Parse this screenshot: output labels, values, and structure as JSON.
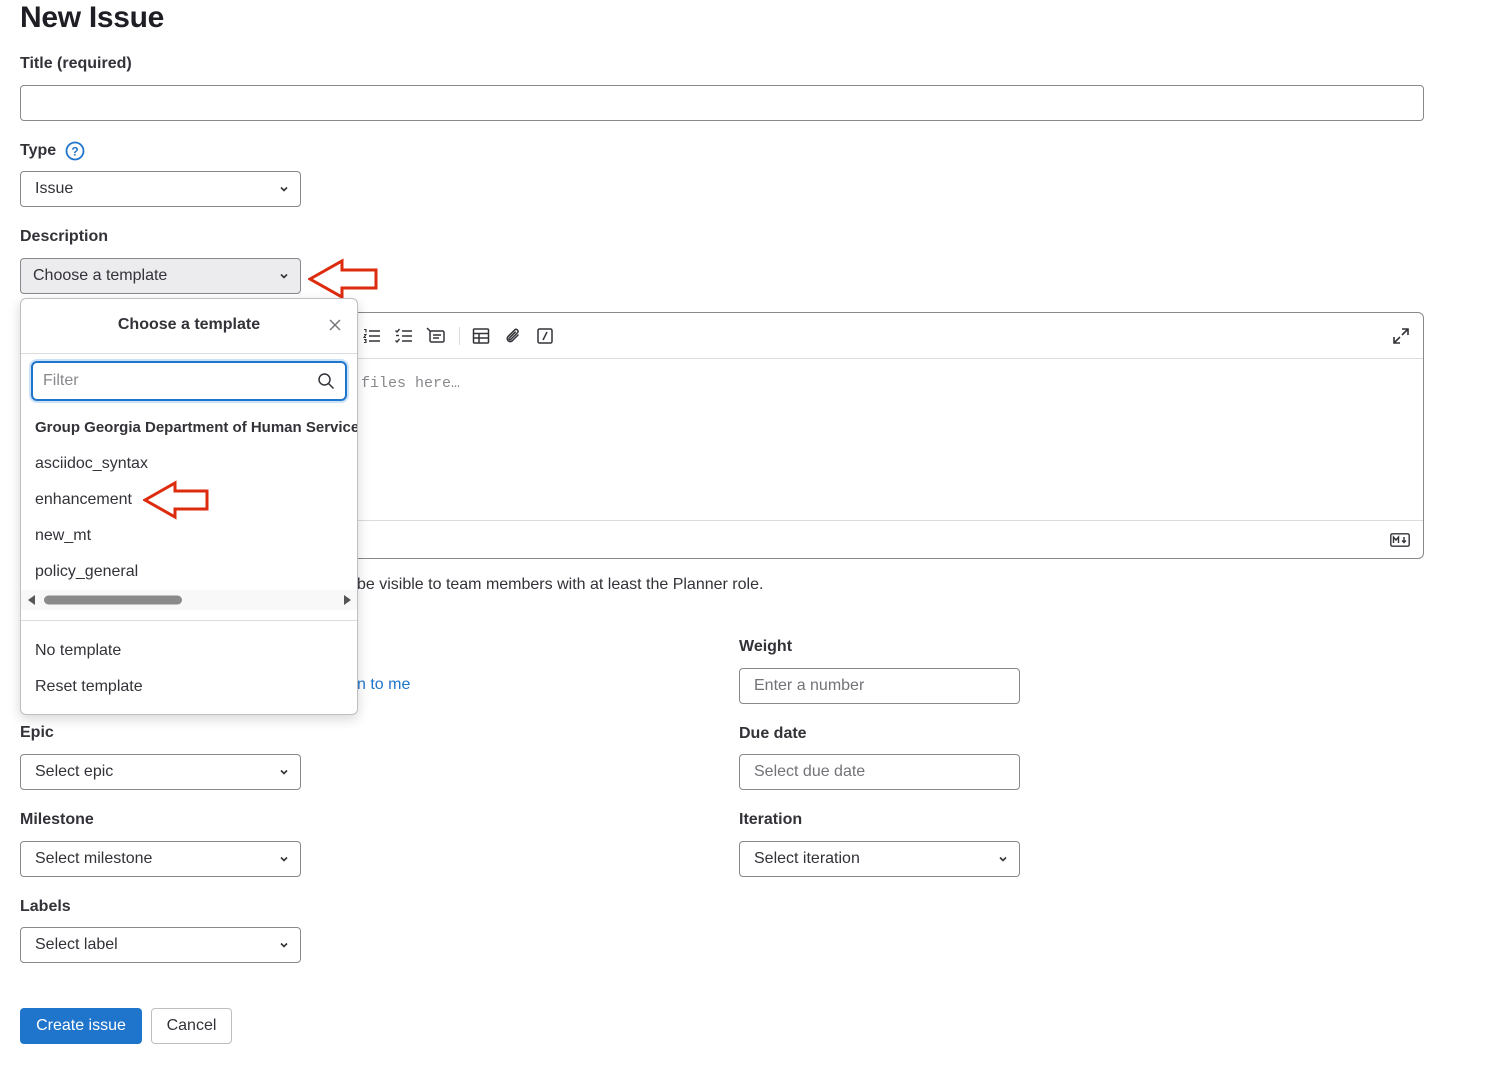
{
  "page": {
    "title": "New Issue"
  },
  "title_field": {
    "label": "Title (required)",
    "value": ""
  },
  "type_field": {
    "label": "Type",
    "value": "Issue"
  },
  "description": {
    "label": "Description",
    "template_button": "Choose a template",
    "editor_placeholder_visible": "files here…",
    "confidential_note_visible": "be visible to team members with at least the Planner role."
  },
  "template_dropdown": {
    "title": "Choose a template",
    "filter_placeholder": "Filter",
    "group_label": "Group Georgia Department of Human Services",
    "items": [
      "asciidoc_syntax",
      "enhancement",
      "new_mt",
      "policy_general"
    ],
    "footer_items": [
      "No template",
      "Reset template"
    ]
  },
  "assignee": {
    "assign_to_me_visible": "n to me"
  },
  "weight": {
    "label": "Weight",
    "placeholder": "Enter a number"
  },
  "epic": {
    "label": "Epic",
    "value": "Select epic"
  },
  "due_date": {
    "label": "Due date",
    "placeholder": "Select due date"
  },
  "milestone": {
    "label": "Milestone",
    "value": "Select milestone"
  },
  "iteration": {
    "label": "Iteration",
    "value": "Select iteration"
  },
  "labels": {
    "label": "Labels",
    "value": "Select label"
  },
  "actions": {
    "create": "Create issue",
    "cancel": "Cancel"
  },
  "colors": {
    "accent": "#1f75cb",
    "annotation_arrow": "#dd2b0e",
    "text": "#333238",
    "border": "#89888d"
  },
  "icons": [
    "help-icon",
    "chevron-down-icon",
    "close-icon",
    "search-icon",
    "bulleted-list-icon",
    "task-list-icon",
    "indent-icon",
    "table-icon",
    "attachment-icon",
    "quick-action-icon",
    "fullscreen-icon",
    "markdown-icon",
    "annotation-arrow"
  ]
}
